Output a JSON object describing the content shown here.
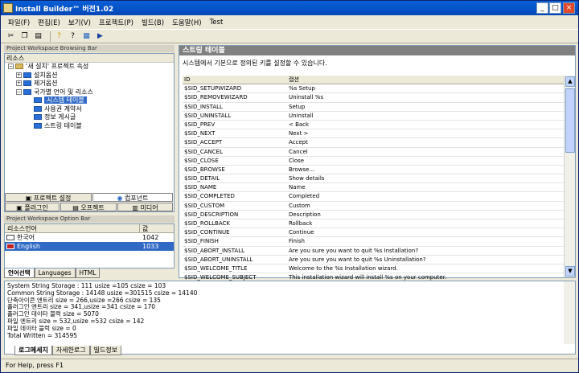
{
  "window": {
    "title": "Install Builder™ 버전1.02"
  },
  "menu": [
    "파일(F)",
    "편집(E)",
    "보기(V)",
    "프로젝트(P)",
    "빌드(B)",
    "도움말(H)",
    "Test"
  ],
  "browse": {
    "title": "Project Workspace Browsing Bar",
    "header": "리소스",
    "root": "'새 설치' 프로젝트 속성",
    "items": [
      "설치옵션",
      "제거옵션",
      "국가별 언어 및 리소스"
    ],
    "subitems": [
      "시스템 테이블",
      "사용권 계약서",
      "정보 게시글",
      "스트링 테이블"
    ],
    "tabs": [
      "프로젝트 설정",
      "컴포넌트",
      "플러그인",
      "오프젝트",
      "미디어"
    ]
  },
  "option": {
    "title": "Project Workspace Option Bar",
    "col1": "리소스언어",
    "col2": "값",
    "rows": [
      {
        "name": "한국어",
        "value": "1042"
      },
      {
        "name": "English",
        "value": "1033"
      }
    ],
    "tabs": [
      "언어선택",
      "Languages",
      "HTML"
    ]
  },
  "main": {
    "heading": "스트링 테이블",
    "desc": "시스템에서 기본으로 정의된 키를 설정할 수 있습니다.",
    "col_id": "ID",
    "col_caption": "캡션",
    "rows": [
      [
        "$SID_SETUPWIZARD",
        "%s Setup"
      ],
      [
        "$SID_REMOVEWIZARD",
        "Uninstall %s"
      ],
      [
        "$SID_INSTALL",
        "Setup"
      ],
      [
        "$SID_UNINSTALL",
        "Uninstall"
      ],
      [
        "$SID_PREV",
        "< Back"
      ],
      [
        "$SID_NEXT",
        "Next >"
      ],
      [
        "$SID_ACCEPT",
        "Accept"
      ],
      [
        "$SID_CANCEL",
        "Cancel"
      ],
      [
        "$SID_CLOSE",
        "Close"
      ],
      [
        "$SID_BROWSE",
        "Browse..."
      ],
      [
        "$SID_DETAIL",
        "Show details"
      ],
      [
        "$SID_NAME",
        "Name"
      ],
      [
        "$SID_COMPLETED",
        "Completed"
      ],
      [
        "$SID_CUSTOM",
        "Custom"
      ],
      [
        "$SID_DESCRIPTION",
        "Description"
      ],
      [
        "$SID_ROLLBACK",
        "Rollback"
      ],
      [
        "$SID_CONTINUE",
        "Continue"
      ],
      [
        "$SID_FINISH",
        "Finish"
      ],
      [
        "$SID_ABORT_INSTALL",
        "Are you sure you want to quit %s Installation?"
      ],
      [
        "$SID_ABORT_UNINSTALL",
        "Are you sure you want to quit %s Uninstallation?"
      ],
      [
        "$SID_WELCOME_TITLE",
        "Welcome to the %s Installation wizard."
      ],
      [
        "$SID_WELCOME_SUBJECT",
        "This installation wizard will install %s on your computer."
      ]
    ]
  },
  "log": {
    "lines": [
      "System String Storage : 111 usize =105 csize = 103",
      "Common String Storage : 14148 usize =301515 csize = 14140",
      "단축아이콘 엔트리 size = 266,usize =266 csize = 135",
      "플러그인 엔트리 size = 341,usize =341 csize = 170",
      "플러그인 데이타 블럭 size = 5070",
      "파일 엔트리 size = 532,usize =532 csize = 142",
      "파일 데이타 블럭 size = 0",
      "Total Written = 314595"
    ],
    "tabs": [
      "로그메세지",
      "자세한로그",
      "빌드정보"
    ]
  },
  "status": "For Help, press F1"
}
